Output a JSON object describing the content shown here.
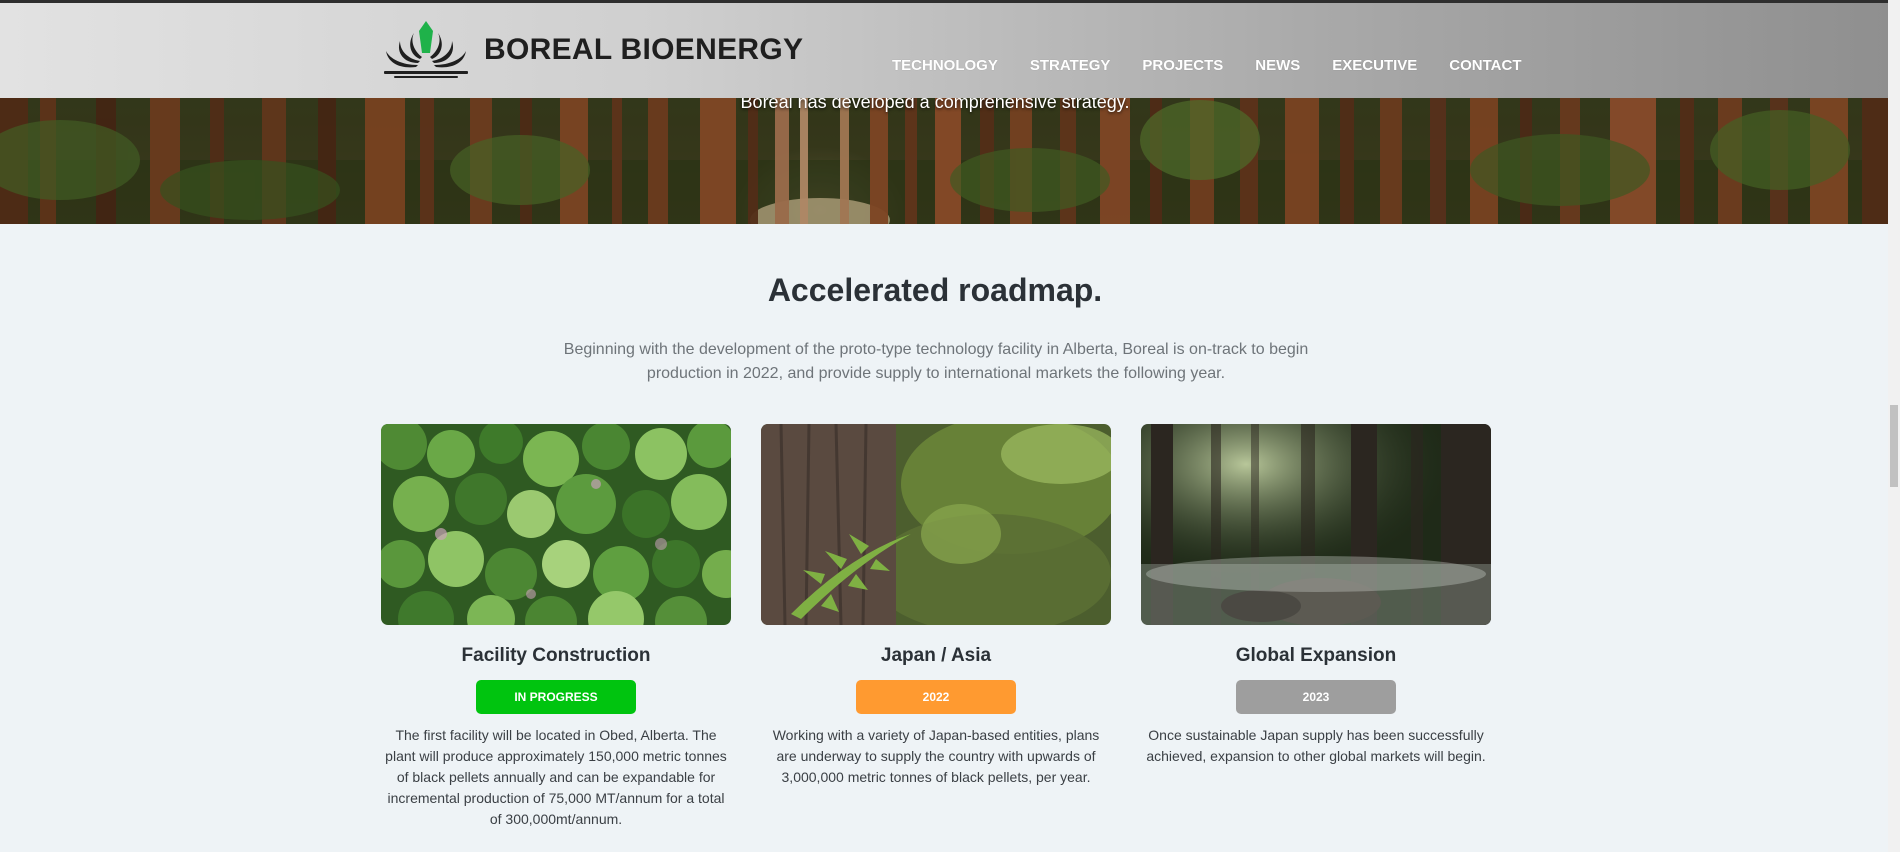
{
  "brand": {
    "name": "BOREAL BIOENERGY",
    "logo_icon": "boreal-leaf-burst-icon",
    "logo_colors": {
      "dark": "#1f1f1f",
      "accent": "#1fb24a"
    }
  },
  "nav": {
    "items": [
      {
        "label": "TECHNOLOGY"
      },
      {
        "label": "STRATEGY"
      },
      {
        "label": "PROJECTS"
      },
      {
        "label": "NEWS"
      },
      {
        "label": "EXECUTIVE"
      },
      {
        "label": "CONTACT"
      }
    ]
  },
  "hero": {
    "text": "Boreal has developed a comprehensive strategy."
  },
  "roadmap": {
    "title": "Accelerated roadmap.",
    "intro": "Beginning with the development of the proto-type technology facility in Alberta, Boreal is on-track to begin production in 2022, and provide supply to international markets the following year.",
    "cards": [
      {
        "title": "Facility Construction",
        "badge": "IN PROGRESS",
        "badge_color": "#00c40f",
        "description": "The first facility will be located in Obed, Alberta. The plant will produce approximately 150,000 metric tonnes of black pellets annually and can be expandable for incremental production of 75,000 MT/annum for a total of 300,000mt/annum."
      },
      {
        "title": "Japan / Asia",
        "badge": "2022",
        "badge_color": "#ff9a30",
        "description": "Working with  a variety of Japan-based entities, plans are underway to supply the country with upwards of 3,000,000 metric tonnes of black pellets, per year."
      },
      {
        "title": "Global Expansion",
        "badge": "2023",
        "badge_color": "#9e9e9e",
        "description": "Once sustainable Japan supply has been successfully achieved, expansion to other global markets will begin."
      }
    ]
  },
  "colors": {
    "page_background": "#eef3f6",
    "title_text": "#2b3137",
    "intro_text": "#6e7479"
  }
}
